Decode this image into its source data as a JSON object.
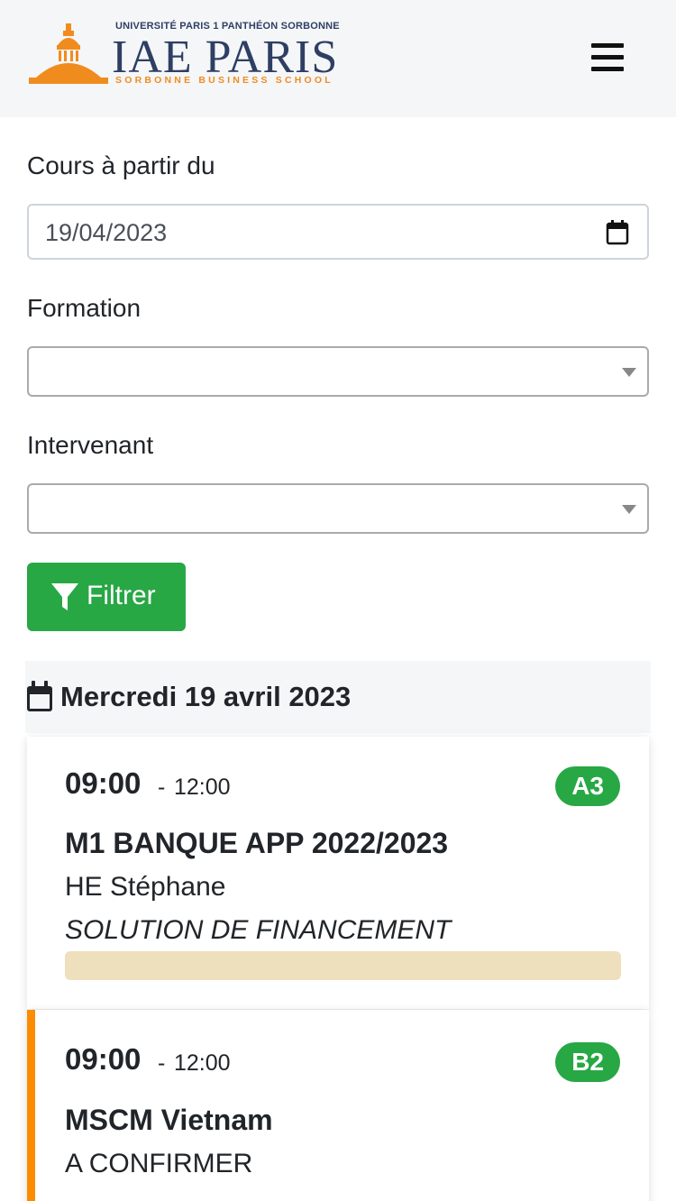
{
  "header": {
    "logo": {
      "top_line": "UNIVERSITÉ PARIS 1 PANTHÉON SORBONNE",
      "main": "IAE PARIS",
      "sub": "SORBONNE BUSINESS SCHOOL"
    },
    "menu_icon": "hamburger-icon"
  },
  "filters": {
    "date_label": "Cours à partir du",
    "date_value": "19/04/2023",
    "formation_label": "Formation",
    "formation_value": "",
    "intervenant_label": "Intervenant",
    "intervenant_value": "",
    "filter_button": "Filtrer",
    "filter_icon": "filter-icon"
  },
  "schedule": {
    "day_title": "Mercredi 19 avril 2023",
    "day_icon": "calendar-icon",
    "sessions": [
      {
        "start": "09:00",
        "separator": "-",
        "end": "12:00",
        "room": "A3",
        "program": "M1 BANQUE APP 2022/2023",
        "teacher": "HE      Stéphane",
        "subject": "SOLUTION DE FINANCEMENT",
        "accent_color": ""
      },
      {
        "start": "09:00",
        "separator": "-",
        "end": "12:00",
        "room": "B2",
        "program": "MSCM Vietnam",
        "teacher": "A CONFIRMER",
        "accent_color": "#fb8c00"
      }
    ]
  },
  "colors": {
    "primary_green": "#28a745",
    "navbar_bg": "#f5f6f8",
    "logo_blue": "#2e3f63",
    "logo_orange": "#f08c1e",
    "accent_orange": "#fb8c00",
    "subject_bar": "#eee0bc"
  }
}
